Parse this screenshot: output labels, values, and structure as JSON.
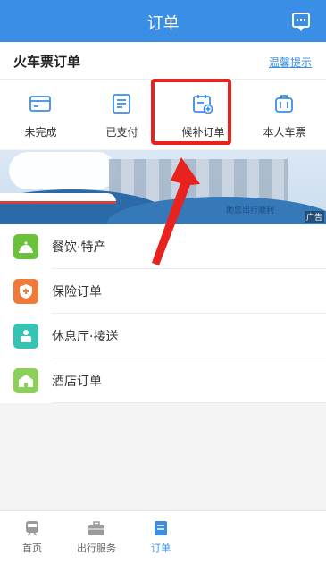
{
  "header": {
    "title": "订单",
    "icon": "message-icon"
  },
  "section": {
    "title": "火车票订单",
    "tip_link": "温馨提示"
  },
  "quick_actions": [
    {
      "label": "未完成",
      "icon": "card-icon"
    },
    {
      "label": "已支付",
      "icon": "receipt-icon"
    },
    {
      "label": "候补订单",
      "icon": "calendar-add-icon",
      "highlighted": true
    },
    {
      "label": "本人车票",
      "icon": "luggage-icon"
    }
  ],
  "banner": {
    "slogan": "助您出行顺利",
    "ad_tag": "广告"
  },
  "menu": [
    {
      "label": "餐饮·特产",
      "icon": "food-bell-icon",
      "color": "#69c23a"
    },
    {
      "label": "保险订单",
      "icon": "shield-icon",
      "color": "#f07a3a"
    },
    {
      "label": "休息厅·接送",
      "icon": "lounge-icon",
      "color": "#35c4b4"
    },
    {
      "label": "酒店订单",
      "icon": "hotel-icon",
      "color": "#8bd05a"
    }
  ],
  "tabbar": [
    {
      "label": "首页",
      "icon": "train-icon"
    },
    {
      "label": "出行服务",
      "icon": "briefcase-icon"
    },
    {
      "label": "订单",
      "icon": "order-icon",
      "active": true
    }
  ],
  "colors": {
    "primary": "#3a8ee6",
    "highlight": "#e8231f"
  }
}
